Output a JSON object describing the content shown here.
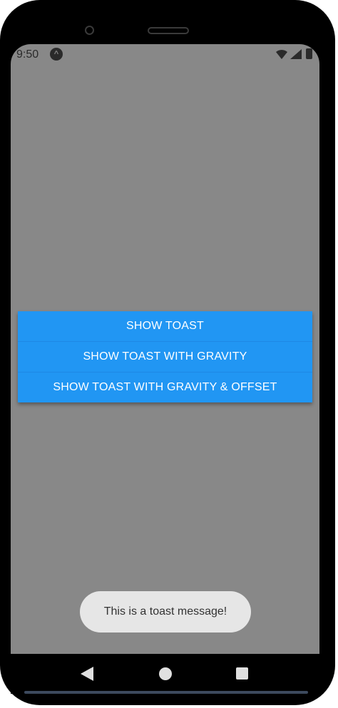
{
  "status_bar": {
    "time": "9:50"
  },
  "buttons": {
    "show_toast": "SHOW TOAST",
    "show_toast_gravity": "SHOW TOAST WITH GRAVITY",
    "show_toast_gravity_offset": "SHOW TOAST WITH GRAVITY & OFFSET"
  },
  "toast": {
    "message": "This is a toast message!"
  },
  "colors": {
    "button_bg": "#2196f3",
    "screen_bg": "#888888",
    "toast_bg": "#e6e6e6"
  },
  "icons": {
    "status": [
      "react-native-icon",
      "wifi-icon",
      "signal-icon",
      "battery-icon"
    ],
    "nav": [
      "back-icon",
      "home-icon",
      "recents-icon"
    ]
  }
}
